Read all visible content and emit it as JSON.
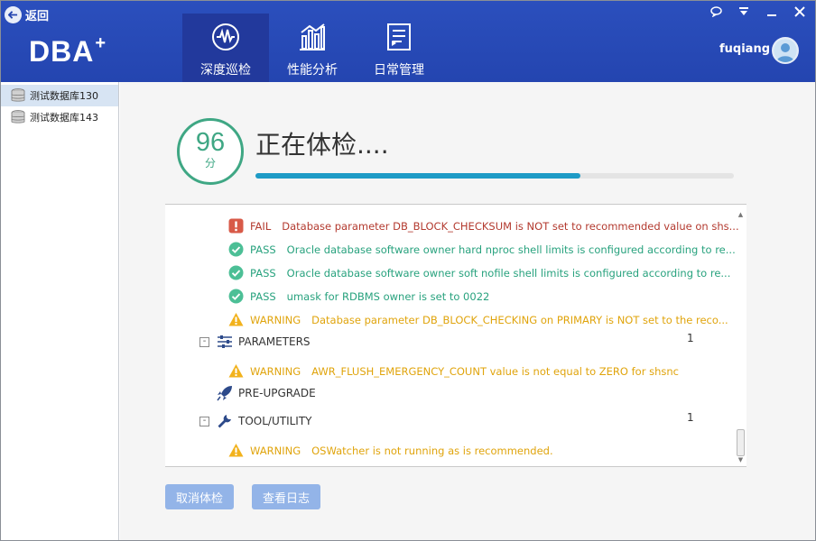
{
  "header": {
    "back_label": "返回",
    "logo_text": "DBA",
    "logo_sup": "+",
    "tabs": [
      {
        "label": "深度巡检",
        "icon": "waveform-icon",
        "active": true
      },
      {
        "label": "性能分析",
        "icon": "bar-chart-icon",
        "active": false
      },
      {
        "label": "日常管理",
        "icon": "checklist-icon",
        "active": false
      }
    ],
    "user": "fuqiang",
    "window_buttons": [
      "chat-icon",
      "menu-icon",
      "minimize-icon",
      "close-icon"
    ]
  },
  "sidebar": {
    "items": [
      {
        "label": "测试数据库130",
        "selected": true
      },
      {
        "label": "测试数据库143",
        "selected": false
      }
    ]
  },
  "status": {
    "score": "96",
    "score_unit": "分",
    "title": "正在体检....",
    "progress_fraction": 0.68
  },
  "checks": [
    {
      "level": "FAIL",
      "text": "Database parameter DB_BLOCK_CHECKSUM is NOT set to recommended value on shs..."
    },
    {
      "level": "PASS",
      "text": "Oracle database software owner hard nproc shell limits is configured according to re..."
    },
    {
      "level": "PASS",
      "text": "Oracle database software owner  soft nofile shell limits is configured according to re..."
    },
    {
      "level": "PASS",
      "text": "umask for RDBMS owner is set to 0022"
    },
    {
      "level": "WARNING",
      "text": "Database parameter DB_BLOCK_CHECKING on PRIMARY is NOT set to the reco..."
    }
  ],
  "sections": [
    {
      "name": "PARAMETERS",
      "count": "1",
      "toggle": "-",
      "icon": "sliders-icon",
      "checks": [
        {
          "level": "WARNING",
          "text": "AWR_FLUSH_EMERGENCY_COUNT value is not equal to ZERO for shsnc"
        }
      ]
    },
    {
      "name": "PRE-UPGRADE",
      "count": "",
      "toggle": "",
      "icon": "rocket-icon",
      "checks": []
    },
    {
      "name": "TOOL/UTILITY",
      "count": "1",
      "toggle": "-",
      "icon": "wrench-icon",
      "checks": [
        {
          "level": "WARNING",
          "text": "OSWatcher is not running as is recommended."
        }
      ]
    }
  ],
  "buttons": {
    "cancel": "取消体检",
    "logs": "查看日志"
  },
  "colors": {
    "header": "#2445b0",
    "pass": "#28a27e",
    "fail": "#b33a2f",
    "warning": "#e0a40c",
    "progress": "#1e9bc6",
    "button": "#93b4e8"
  }
}
